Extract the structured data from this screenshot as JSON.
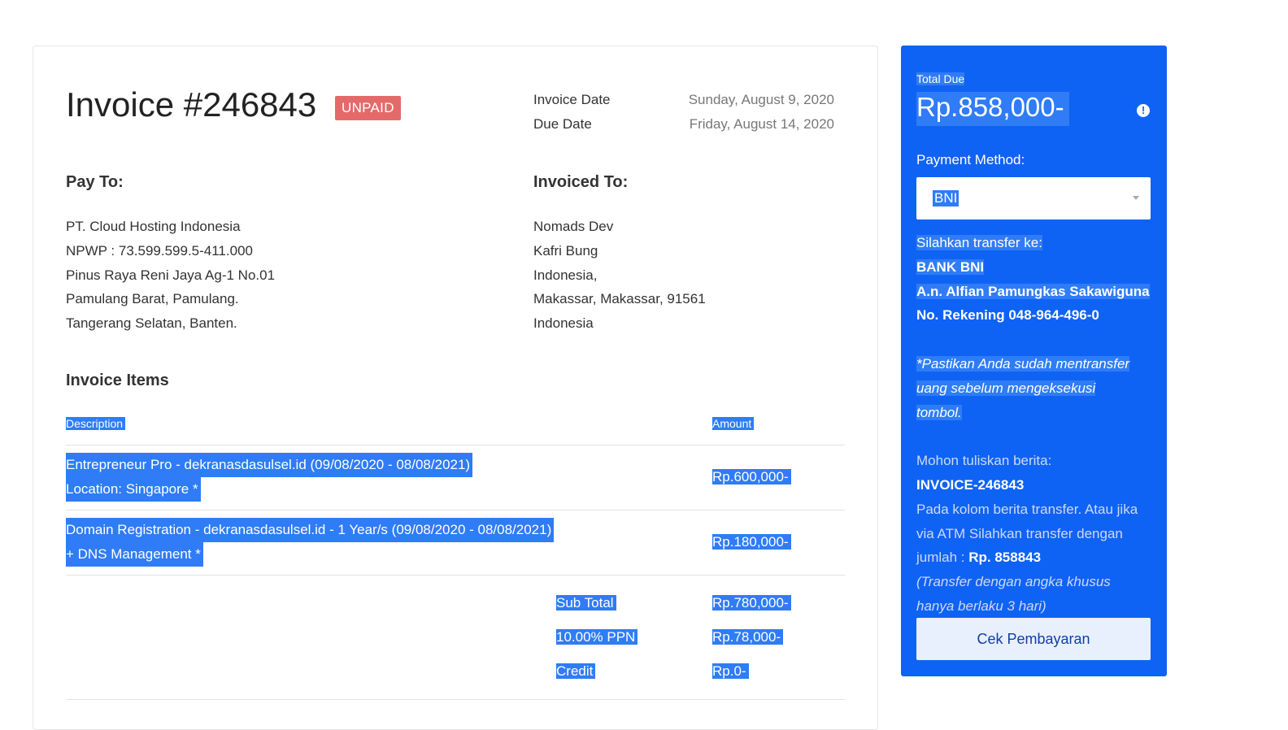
{
  "invoice": {
    "title": "Invoice #246843",
    "status": "UNPAID",
    "invoice_date_label": "Invoice Date",
    "invoice_date": "Sunday, August 9, 2020",
    "due_date_label": "Due Date",
    "due_date": "Friday, August 14, 2020"
  },
  "pay_to": {
    "heading": "Pay To:",
    "lines": [
      "PT. Cloud Hosting Indonesia",
      "NPWP : 73.599.599.5-411.000",
      "Pinus Raya Reni Jaya Ag-1 No.01",
      "Pamulang Barat, Pamulang.",
      "Tangerang Selatan, Banten."
    ]
  },
  "invoiced_to": {
    "heading": "Invoiced To:",
    "lines": [
      "Nomads Dev",
      "Kafri Bung",
      "Indonesia,",
      "Makassar, Makassar, 91561",
      "Indonesia"
    ]
  },
  "items": {
    "heading": "Invoice Items",
    "col_description": "Description",
    "col_amount": "Amount",
    "rows": [
      {
        "line1": "Entrepreneur Pro - dekranasdasulsel.id (09/08/2020 - 08/08/2021)",
        "line2": "Location: Singapore *",
        "amount": "Rp.600,000-"
      },
      {
        "line1": "Domain Registration - dekranasdasulsel.id - 1 Year/s (09/08/2020 - 08/08/2021)",
        "line2": "+ DNS Management *",
        "amount": "Rp.180,000-"
      }
    ],
    "totals": [
      {
        "label": "Sub Total",
        "amount": "Rp.780,000-"
      },
      {
        "label": "10.00% PPN",
        "amount": "Rp.78,000-"
      },
      {
        "label": "Credit",
        "amount": "Rp.0-"
      }
    ]
  },
  "sidebar": {
    "total_due_label": "Total Due",
    "total_due": "Rp.858,000-",
    "info_icon": "info-icon",
    "payment_method_label": "Payment Method:",
    "payment_method_value": "BNI",
    "transfer_label": "Silahkan transfer ke:",
    "bank": "BANK BNI",
    "account_name": "A.n. Alfian Pamungkas Sakawiguna",
    "account_number": "No. Rekening 048-964-496-0",
    "note_lines": [
      "*Pastikan Anda sudah mentransfer",
      "uang sebelum mengeksekusi",
      "tombol."
    ],
    "berita_label": "Mohon tuliskan berita:",
    "berita_value": "INVOICE-246843",
    "instr_line1": "Pada kolom berita transfer. Atau jika",
    "instr_line2": "via ATM Silahkan transfer dengan",
    "instr_line3_prefix": "jumlah : ",
    "instr_amount": "Rp. 858843",
    "special_note_line1": "(Transfer dengan angka khusus",
    "special_note_line2": "hanya berlaku 3 hari)",
    "button_label": "Cek Pembayaran"
  },
  "colors": {
    "sidebar_bg": "#0f63f4",
    "selection": "#2f7cf6",
    "unpaid_badge": "#e46a6a"
  }
}
